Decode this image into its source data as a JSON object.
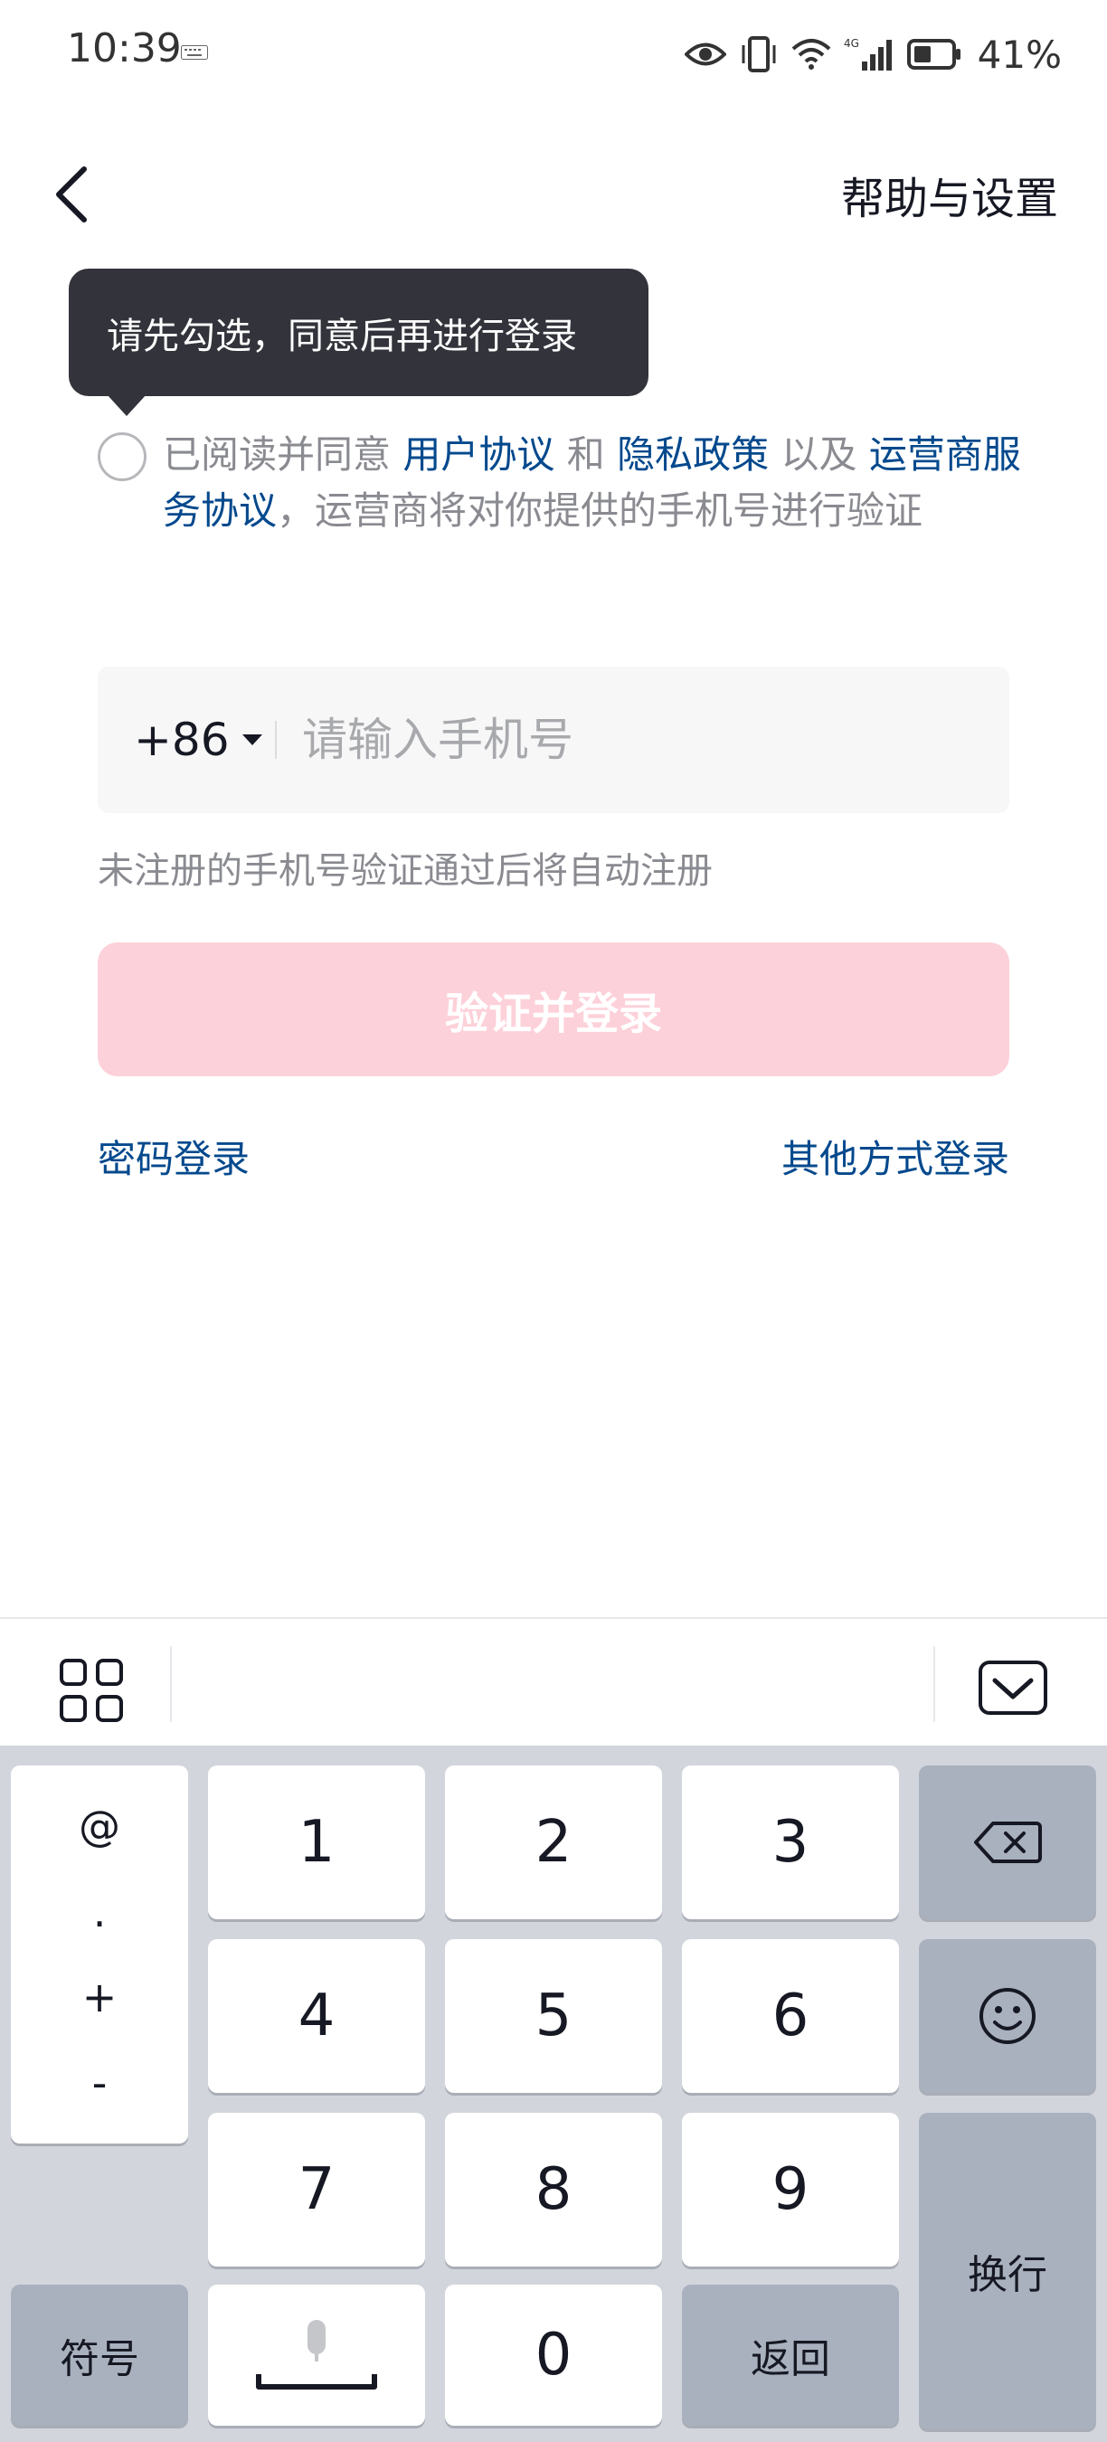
{
  "status_bar": {
    "time": "10:39",
    "battery": "41%",
    "network": "4G"
  },
  "header": {
    "help_label": "帮助与设置"
  },
  "tooltip": {
    "text": "请先勾选，同意后再进行登录"
  },
  "agreement": {
    "prefix": "已阅读并同意",
    "user_agreement": "用户协议",
    "and": "和",
    "privacy_policy": "隐私政策",
    "also": "以及",
    "carrier_agreement": "运营商服务协议",
    "suffix": "，运营商将对你提供的手机号进行验证"
  },
  "phone_input": {
    "country_code": "+86",
    "placeholder": "请输入手机号",
    "value": ""
  },
  "hint": "未注册的手机号验证通过后将自动注册",
  "login_button": "验证并登录",
  "password_login": "密码登录",
  "other_login": "其他方式登录",
  "keyboard": {
    "symbols": [
      "@",
      ".",
      "+",
      "-"
    ],
    "digits": [
      "1",
      "2",
      "3",
      "4",
      "5",
      "6",
      "7",
      "8",
      "9",
      "0"
    ],
    "symbol_key": "符号",
    "return_key": "返回",
    "newline_key": "换行"
  },
  "colors": {
    "link": "#04498d",
    "button_disabled": "#fdd1d9",
    "tooltip_bg": "#33343b"
  }
}
